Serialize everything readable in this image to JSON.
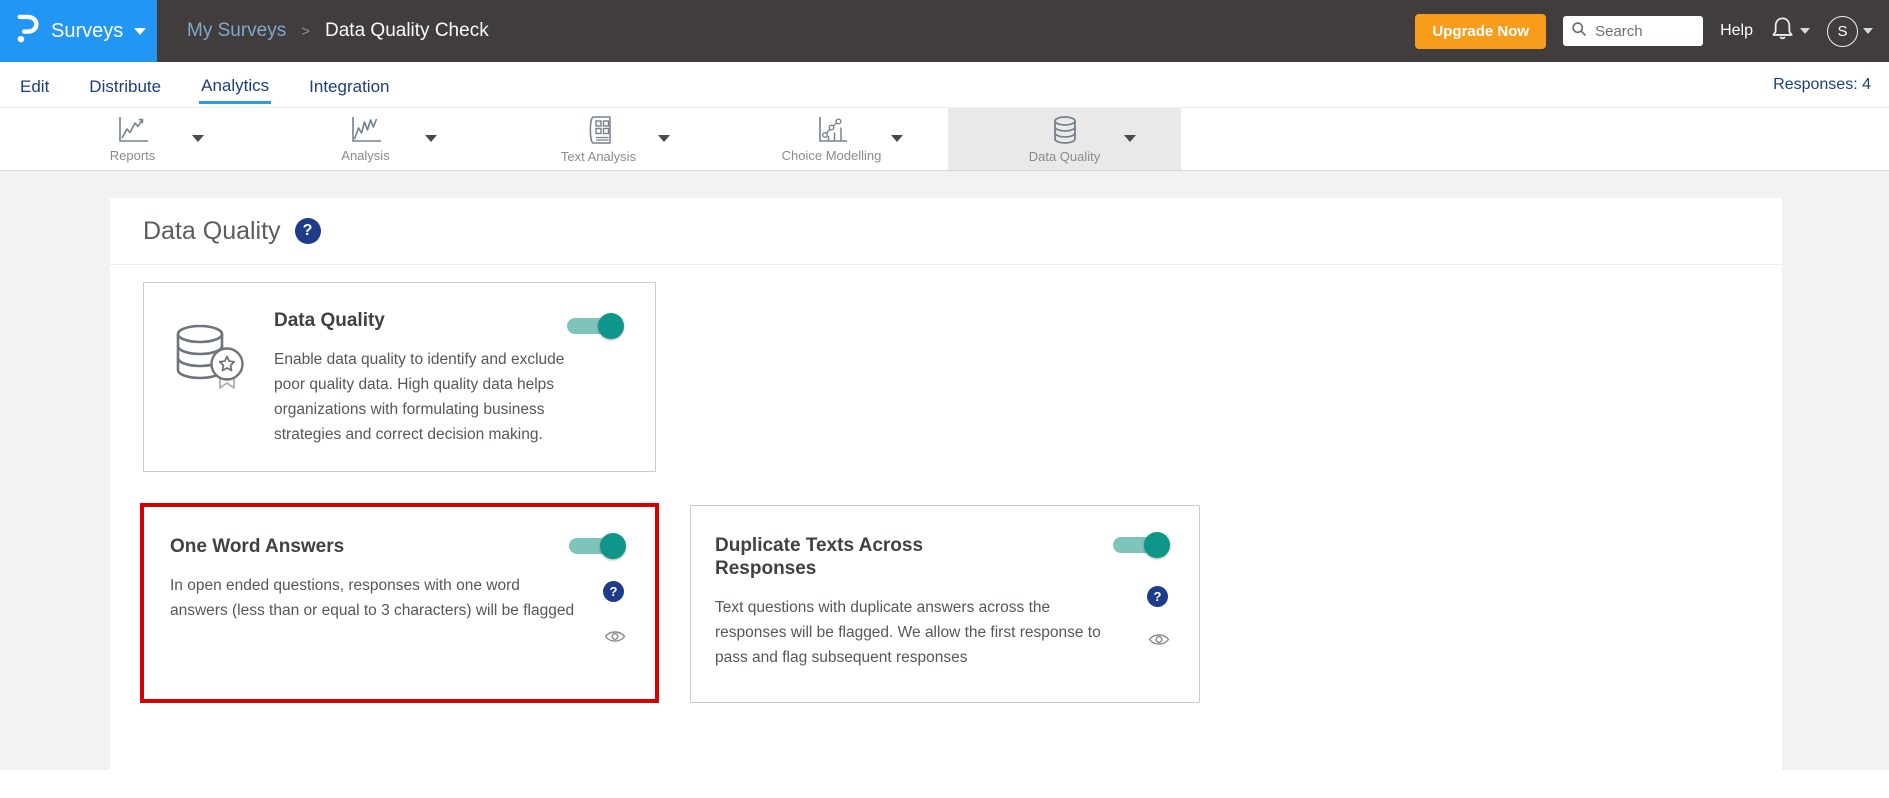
{
  "colors": {
    "header_bg": "#413d3c",
    "brand_blue": "#2196f3",
    "upgrade_orange": "#f89c1b",
    "nav_navy": "#1c3e80",
    "analytics_underline": "#2d9cdb",
    "toggle_teal": "#0f968a",
    "toggle_track": "#7fc4bc",
    "highlight_red": "#d60000",
    "help_badge_blue": "#1e3c87"
  },
  "header": {
    "product": "Surveys",
    "breadcrumb": {
      "parent": "My Surveys",
      "separator": ">",
      "current": "Data Quality Check"
    },
    "upgrade_button": "Upgrade Now",
    "search": {
      "placeholder": "Search"
    },
    "help_label": "Help",
    "avatar_initial": "S"
  },
  "nav": {
    "items": [
      {
        "label": "Edit",
        "active": false
      },
      {
        "label": "Distribute",
        "active": false
      },
      {
        "label": "Analytics",
        "active": true
      },
      {
        "label": "Integration",
        "active": false
      }
    ],
    "responses": "Responses: 4"
  },
  "tabs": {
    "items": [
      {
        "label": "Reports",
        "icon": "line-chart-icon",
        "active": false
      },
      {
        "label": "Analysis",
        "icon": "zigzag-chart-icon",
        "active": false
      },
      {
        "label": "Text Analysis",
        "icon": "report-document-icon",
        "active": false
      },
      {
        "label": "Choice Modelling",
        "icon": "scatter-chart-icon",
        "active": false
      },
      {
        "label": "Data Quality",
        "icon": "database-icon",
        "active": true
      }
    ]
  },
  "main": {
    "title": "Data Quality",
    "help_glyph": "?",
    "cards": [
      {
        "title": "Data Quality",
        "icon": "database-badge-icon",
        "toggle": "on",
        "body": "Enable data quality to identify and exclude\npoor quality data. High quality data helps\norganizations with formulating business\nstrategies and correct decision making.",
        "highlighted": false
      },
      {
        "title": "One Word Answers",
        "toggle": "on",
        "body": "In open ended questions, responses with one word\nanswers (less than or equal to 3 characters) will be flagged",
        "highlighted": true
      },
      {
        "title": "Duplicate Texts Across\nResponses",
        "toggle": "on",
        "body": "Text questions with duplicate answers across the\nresponses will be flagged. We allow the first response to\npass and flag subsequent responses",
        "highlighted": false
      }
    ]
  }
}
